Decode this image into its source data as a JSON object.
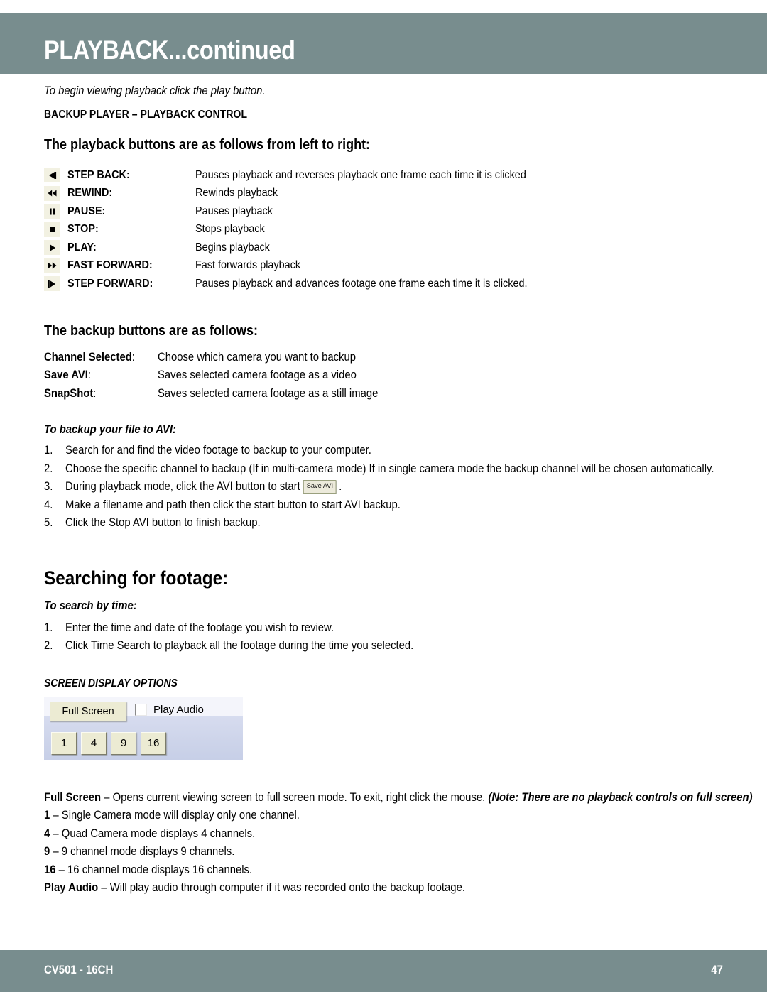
{
  "header": {
    "title": "PLAYBACK...continued",
    "bar_color": "#788d8e"
  },
  "intro": {
    "line": "To begin viewing playback click the play button.",
    "subhead": "BACKUP PLAYER – PLAYBACK CONTROL"
  },
  "playback_section": {
    "heading": "The playback buttons are as follows from left to right:",
    "rows": [
      {
        "icon": "step-back-icon",
        "label": "STEP BACK:",
        "desc": "Pauses playback and reverses playback one frame each time it is clicked"
      },
      {
        "icon": "rewind-icon",
        "label": "REWIND:",
        "desc": "Rewinds playback"
      },
      {
        "icon": "pause-icon",
        "label": "PAUSE:",
        "desc": "Pauses playback"
      },
      {
        "icon": "stop-icon",
        "label": "STOP:",
        "desc": "Stops playback"
      },
      {
        "icon": "play-icon",
        "label": "PLAY:",
        "desc": "Begins playback"
      },
      {
        "icon": "fast-forward-icon",
        "label": "FAST FORWARD:",
        "desc": "Fast forwards playback"
      },
      {
        "icon": "step-forward-icon",
        "label": "STEP FORWARD:",
        "desc": "Pauses playback and advances footage one frame each time it is clicked."
      }
    ],
    "icon_bg": "#f2f1e2"
  },
  "backup_section": {
    "heading": "The backup buttons are as follows:",
    "rows": [
      {
        "term": "Channel Selected",
        "desc": "Choose which camera you want to backup"
      },
      {
        "term": "Save AVI",
        "desc": "Saves selected camera footage as a video"
      },
      {
        "term": "SnapShot",
        "desc": "Saves selected camera footage as a still image"
      }
    ],
    "avi_heading": "To backup your file to AVI:",
    "avi_steps": [
      {
        "num": "1.",
        "text_before": "Search for and find the video footage to backup to your computer.",
        "button": "",
        "text_after": ""
      },
      {
        "num": "2.",
        "text_before": "Choose the specific channel to backup (If in multi-camera mode) If in single camera mode the backup channel will be chosen automatically.",
        "button": "",
        "text_after": ""
      },
      {
        "num": "3.",
        "text_before": "During playback mode, click the AVI button to start",
        "button": "Save AVI",
        "text_after": "."
      },
      {
        "num": "4.",
        "text_before": "Make a filename and path then click the start button to start AVI backup.",
        "button": "",
        "text_after": ""
      },
      {
        "num": "5.",
        "text_before": "Click the Stop AVI button to finish backup.",
        "button": "",
        "text_after": ""
      }
    ]
  },
  "search_section": {
    "heading": "Searching for footage:",
    "subheading": "To search by time:",
    "steps": [
      {
        "num": "1.",
        "text": "Enter the time and date of the footage you wish to review."
      },
      {
        "num": "2.",
        "text": "Click Time Search to playback all the footage during the time you selected."
      }
    ]
  },
  "screen_display": {
    "heading": "SCREEN DISPLAY OPTIONS",
    "widget": {
      "fullscreen_button": "Full Screen",
      "play_audio_label": "Play Audio",
      "play_audio_checked": false,
      "channel_buttons": [
        "1",
        "4",
        "9",
        "16"
      ],
      "button_face_color": "#ecebd3",
      "panel_color": "#d7dcef"
    },
    "definitions": [
      {
        "term": "Full Screen",
        "dash": " – ",
        "desc": "Opens current viewing screen to full screen mode. To exit, right click the mouse. ",
        "note": "(Note: There are no playback controls on full screen)"
      },
      {
        "term": "1",
        "dash": " – ",
        "desc": "Single Camera mode will display only one channel.",
        "note": ""
      },
      {
        "term": "4",
        "dash": " – ",
        "desc": "Quad Camera mode displays 4 channels.",
        "note": ""
      },
      {
        "term": "9",
        "dash": " – ",
        "desc": "9 channel mode displays 9 channels.",
        "note": ""
      },
      {
        "term": "16",
        "dash": " – ",
        "desc": "16 channel mode displays 16 channels.",
        "note": ""
      },
      {
        "term": "Play Audio",
        "dash": " – ",
        "desc": "Will play audio through computer if it was recorded onto the backup footage.",
        "note": ""
      }
    ]
  },
  "footer": {
    "model": "CV501 - 16CH",
    "page_number": "47",
    "bar_color": "#788d8e"
  }
}
